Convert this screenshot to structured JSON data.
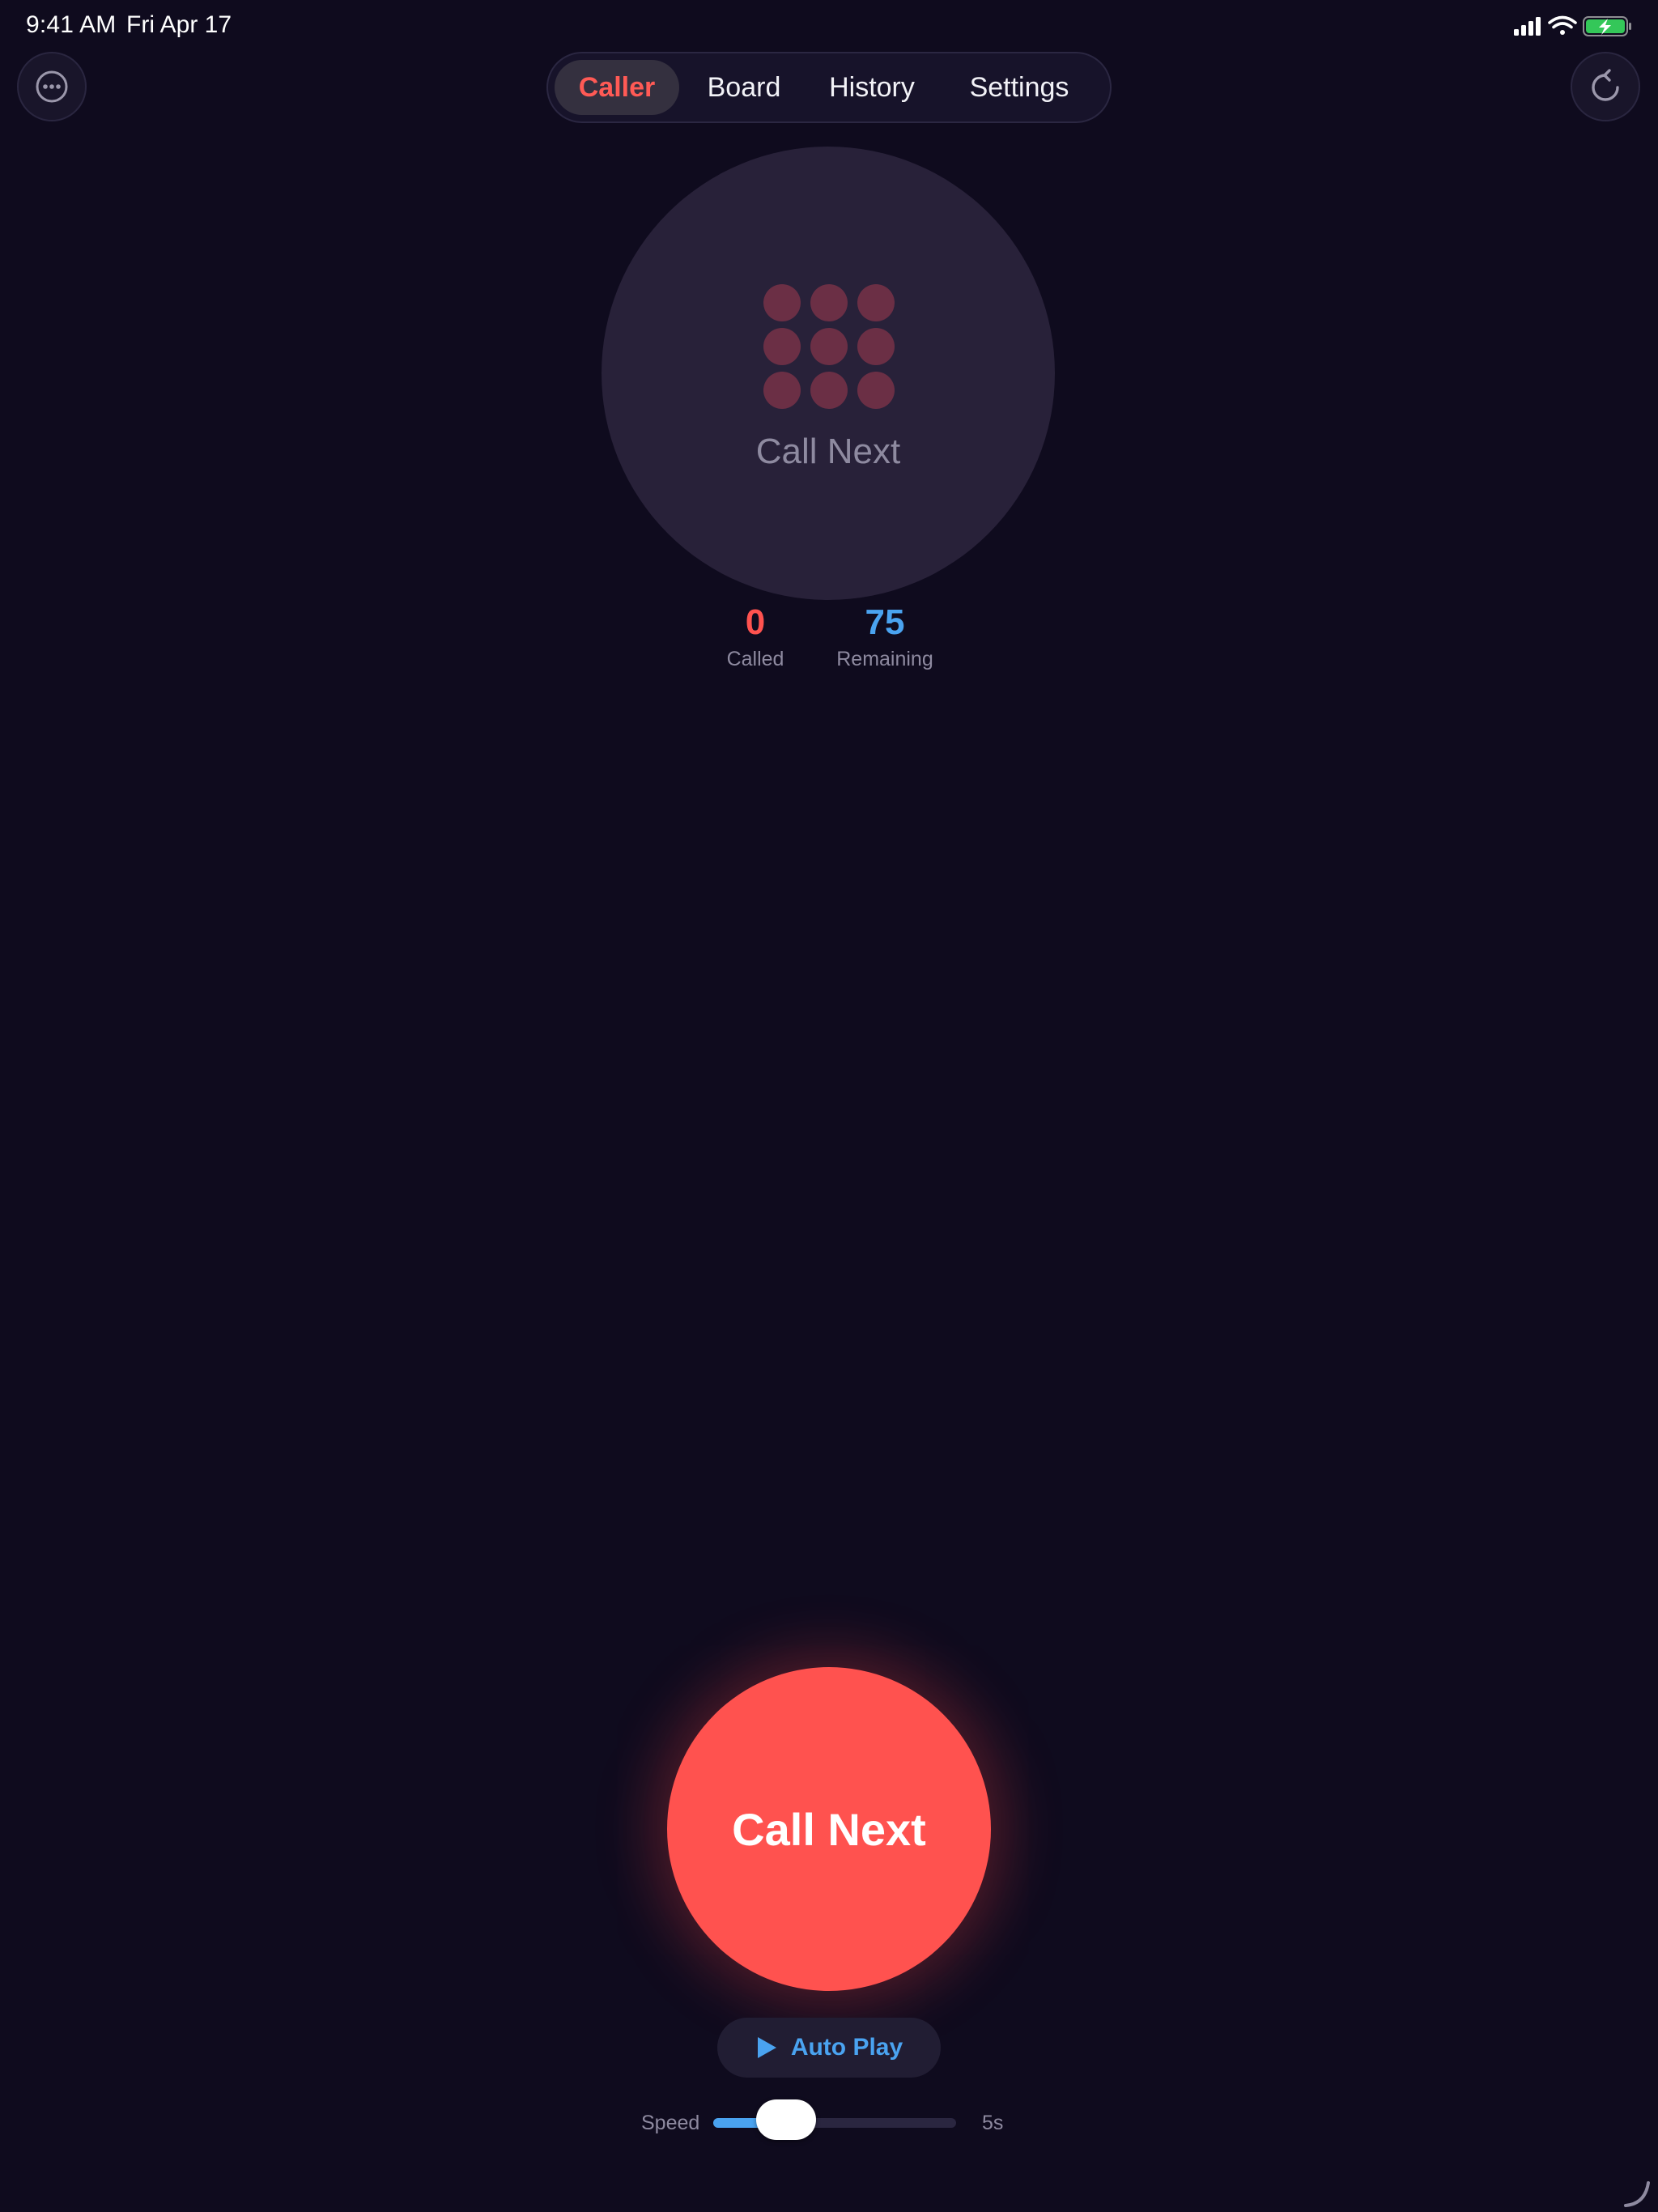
{
  "status_bar": {
    "time": "9:41 AM",
    "date": "Fri Apr 17",
    "battery_color": "#34c759"
  },
  "header": {
    "more_icon": "ellipsis-circle-icon",
    "reset_icon": "counterclockwise-arrow-icon",
    "tabs": [
      {
        "label": "Caller",
        "active": true
      },
      {
        "label": "Board",
        "active": false
      },
      {
        "label": "History",
        "active": false
      },
      {
        "label": "Settings",
        "active": false
      }
    ]
  },
  "ball_display": {
    "icon": "dot-grid-icon",
    "label": "Call Next"
  },
  "counters": {
    "called": {
      "value": "0",
      "label": "Called",
      "color": "#ff524f"
    },
    "remaining": {
      "value": "75",
      "label": "Remaining",
      "color": "#4aa3f0"
    }
  },
  "actions": {
    "call_next_label": "Call Next",
    "call_next_color": "#ff524f",
    "auto_play_label": "Auto Play",
    "auto_play_icon": "play-icon"
  },
  "speed": {
    "label": "Speed",
    "value_label": "5s",
    "level": 0.3
  }
}
